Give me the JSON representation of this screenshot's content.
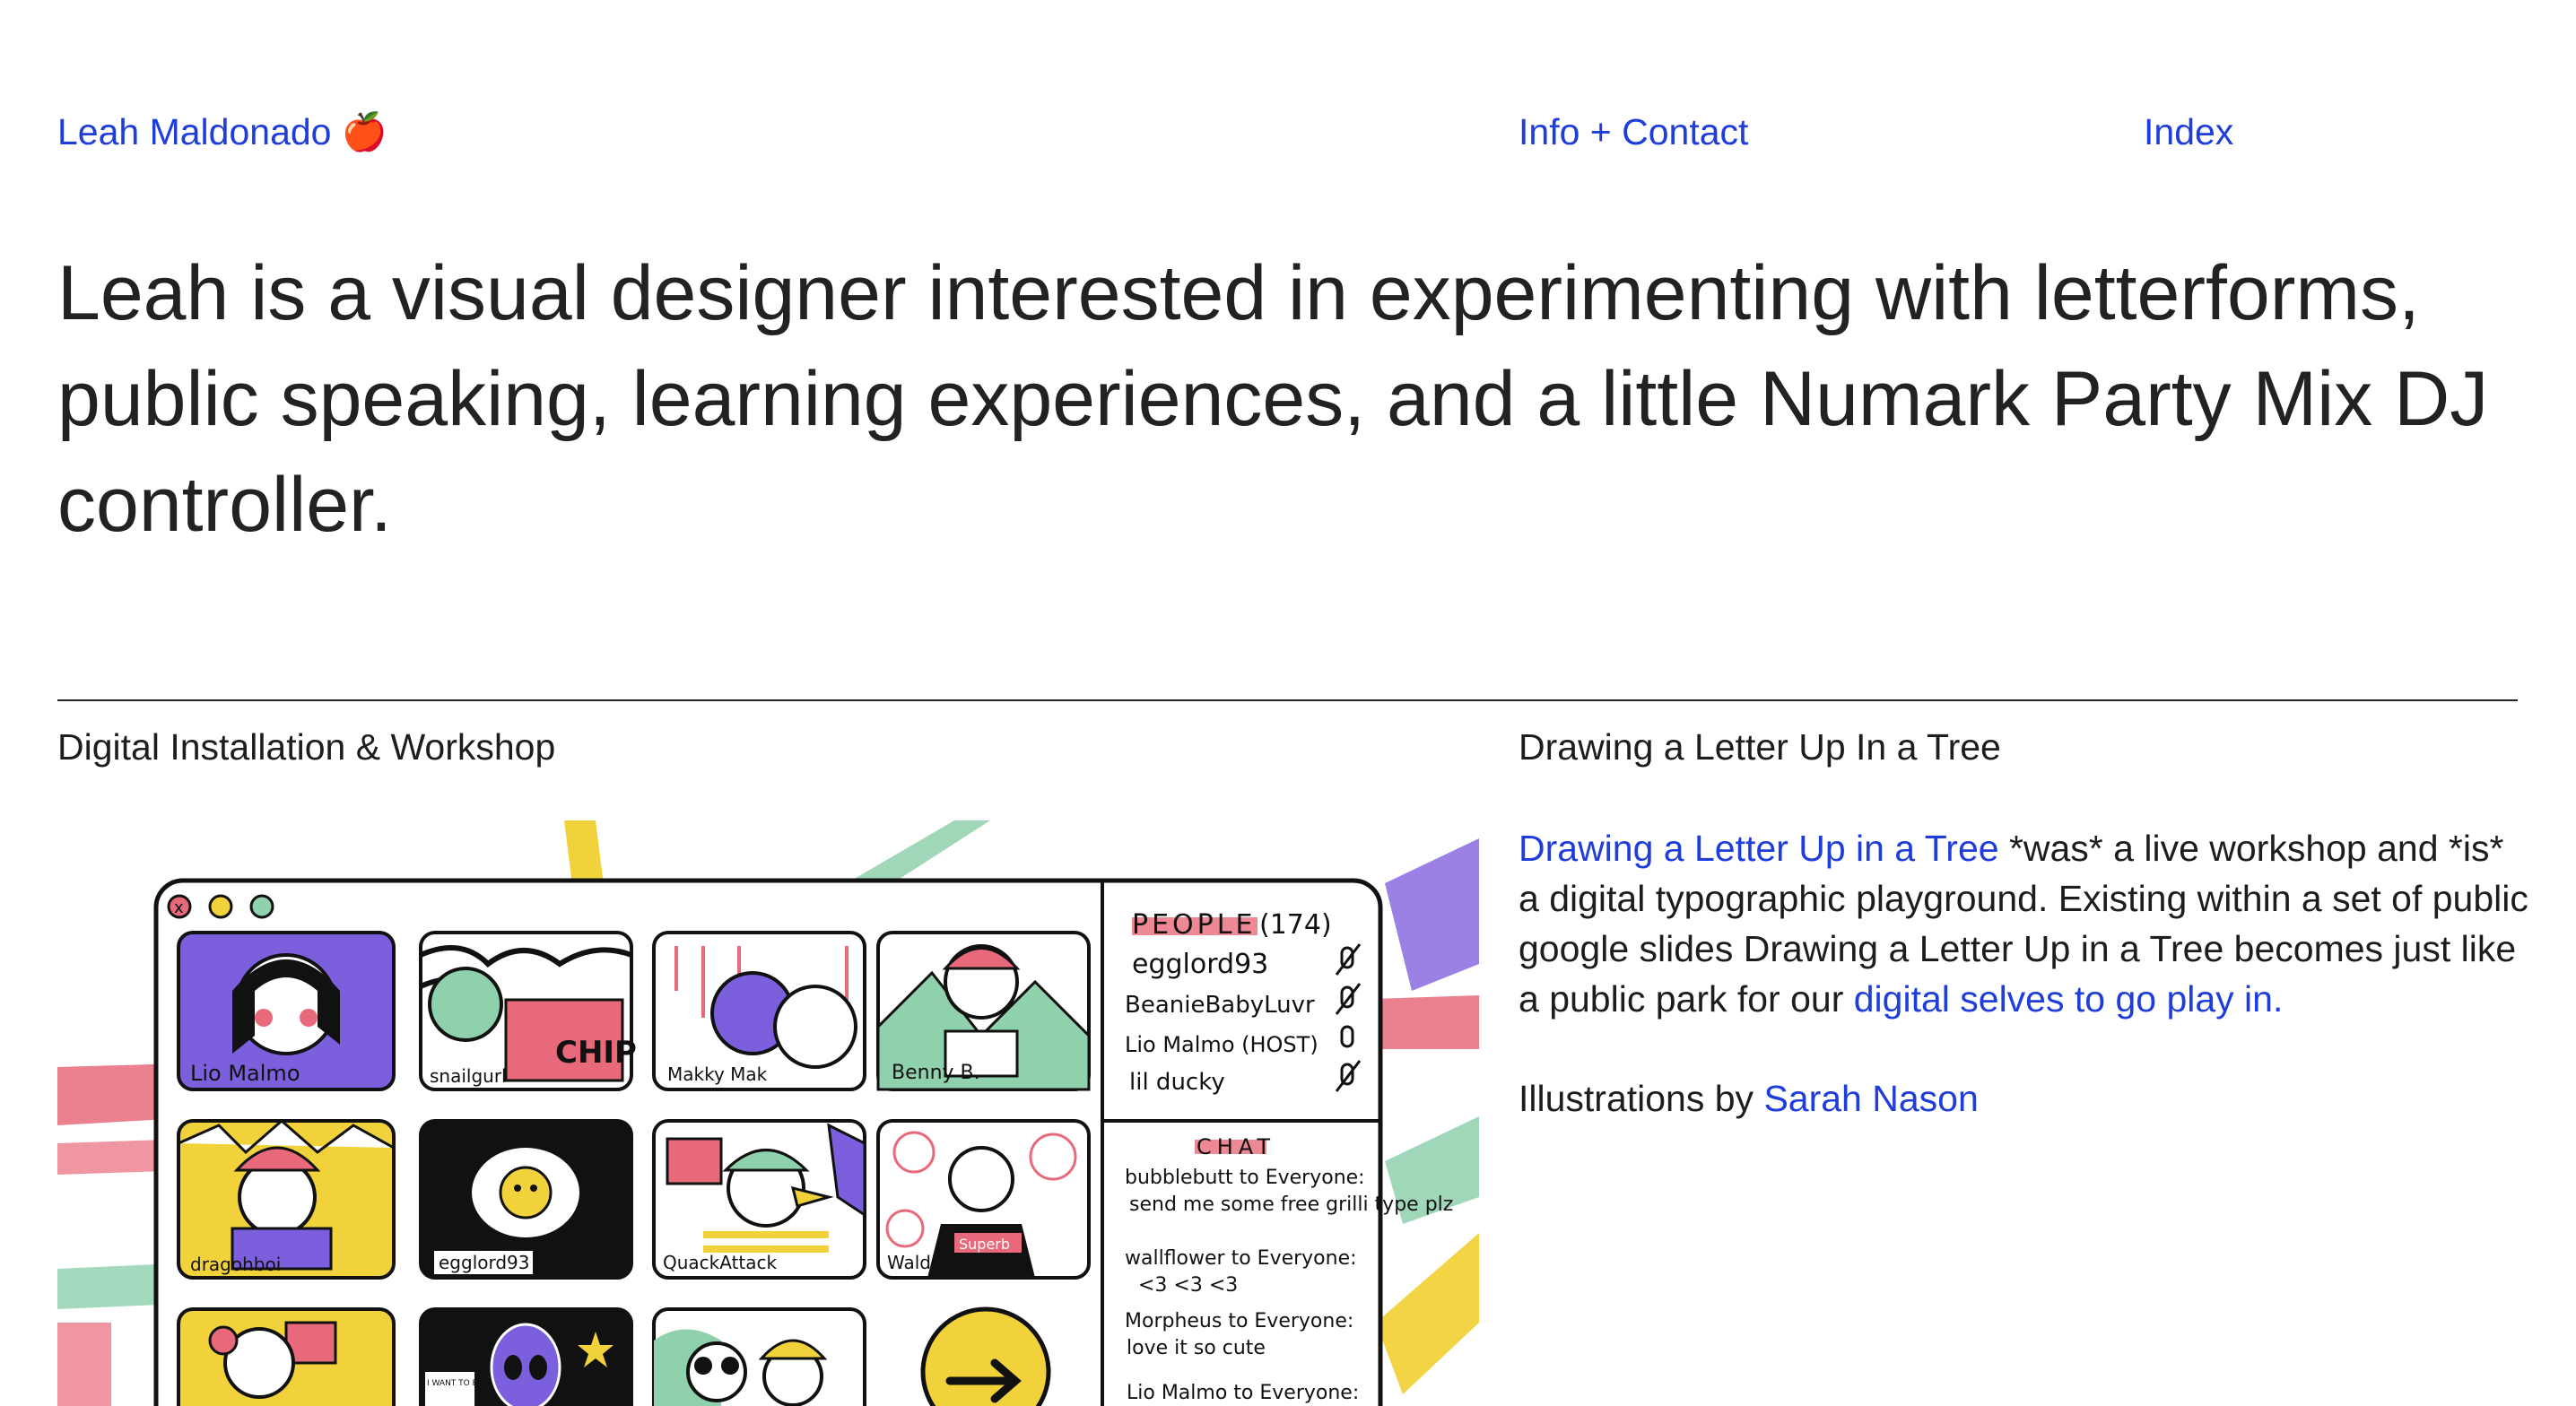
{
  "nav": {
    "home_label": "Leah Maldonado 🍎",
    "info_label": "Info + Contact",
    "index_label": "Index"
  },
  "intro": "Leah is a visual designer interested in experimenting with letterforms, public speaking, learning experiences, and a little Numark Party Mix DJ controller.",
  "project": {
    "type": "Digital Installation & Workshop",
    "title": "Drawing a Letter Up In a Tree",
    "desc_link": "Drawing a Letter Up in a Tree",
    "desc_text": " *was* a live workshop and *is* a digital typographic playground. Existing within a set of public google slides Drawing a Letter Up in a Tree becomes just like a public park for our ",
    "desc_link2": "digital selves to go play in.",
    "credit_prefix": "Illustrations by ",
    "credit_link": "Sarah Nason"
  },
  "illustration": {
    "participants": [
      "Lio Malmo",
      "snailgurl",
      "Makky Mak",
      "Benny B.",
      "dragohboi",
      "egglord93",
      "QuackAttack",
      "Waldorf"
    ],
    "people_title": "PEOPLE",
    "people_count": "(174)",
    "people": [
      "egglord93",
      "BeanieBabyLuvr",
      "Lio Malmo (HOST)",
      "lil ducky"
    ],
    "chat_title": "CHAT",
    "chat": [
      {
        "from": "bubblebutt to Everyone:",
        "msg": "send me some free grilli type plz"
      },
      {
        "from": "wallflower to Everyone:",
        "msg": "<3 <3 <3"
      },
      {
        "from": "Morpheus to Everyone:",
        "msg": "love it so cute"
      },
      {
        "from": "Lio Malmo to Everyone:",
        "msg": ""
      }
    ],
    "chip_text": "CHIP",
    "shirt_text": "Superb",
    "poster_text": "I WANT TO BELIEVE"
  }
}
